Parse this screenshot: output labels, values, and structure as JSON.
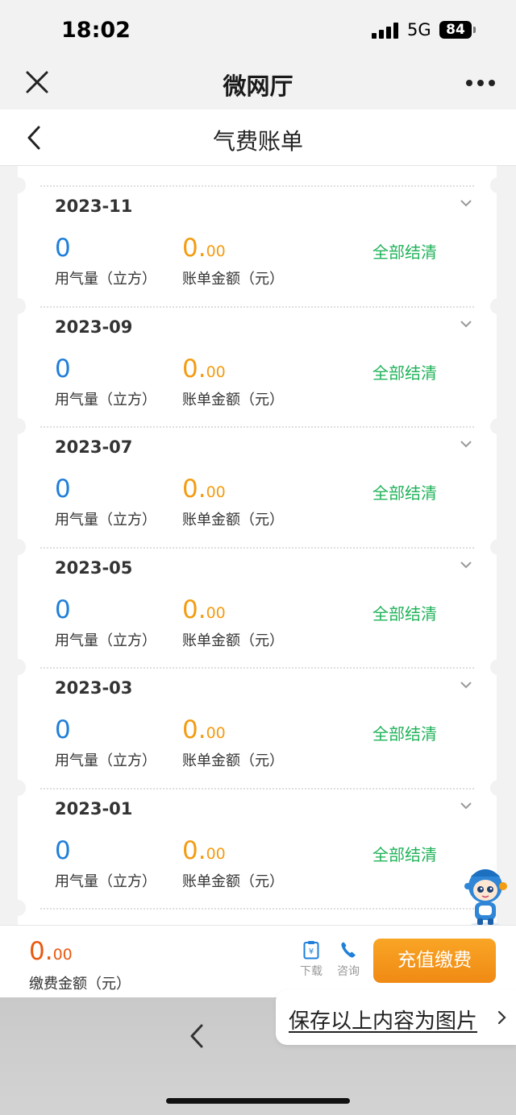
{
  "status_bar": {
    "time": "18:02",
    "network": "5G",
    "battery": "84"
  },
  "app_nav": {
    "title": "微网厅"
  },
  "page": {
    "title": "气费账单"
  },
  "bills": [
    {
      "date": "2023-11",
      "gas_value": "0",
      "gas_label": "用气量（立方）",
      "amount_int": "0.",
      "amount_dec": "00",
      "amount_label": "账单金额（元）",
      "status": "全部结清"
    },
    {
      "date": "2023-09",
      "gas_value": "0",
      "gas_label": "用气量（立方）",
      "amount_int": "0.",
      "amount_dec": "00",
      "amount_label": "账单金额（元）",
      "status": "全部结清"
    },
    {
      "date": "2023-07",
      "gas_value": "0",
      "gas_label": "用气量（立方）",
      "amount_int": "0.",
      "amount_dec": "00",
      "amount_label": "账单金额（元）",
      "status": "全部结清"
    },
    {
      "date": "2023-05",
      "gas_value": "0",
      "gas_label": "用气量（立方）",
      "amount_int": "0.",
      "amount_dec": "00",
      "amount_label": "账单金额（元）",
      "status": "全部结清"
    },
    {
      "date": "2023-03",
      "gas_value": "0",
      "gas_label": "用气量（立方）",
      "amount_int": "0.",
      "amount_dec": "00",
      "amount_label": "账单金额（元）",
      "status": "全部结清"
    },
    {
      "date": "2023-01",
      "gas_value": "0",
      "gas_label": "用气量（立方）",
      "amount_int": "0.",
      "amount_dec": "00",
      "amount_label": "账单金额（元）",
      "status": "全部结清"
    }
  ],
  "bottom_bar": {
    "total_int": "0.",
    "total_dec": "00",
    "total_label": "缴费金额（元）",
    "download_label": "下载",
    "consult_label": "咨询",
    "pay_button": "充值缴费"
  },
  "save_image": {
    "label": "保存以上内容为图片"
  },
  "colors": {
    "gas_value": "#1f7fd9",
    "amount_value": "#f39c12",
    "status_settled": "#21b35a",
    "total_amount": "#e85a10",
    "pay_button": "#f39217"
  },
  "icons": [
    "close-icon",
    "more-icon",
    "back-icon",
    "chevron-down-icon",
    "download-icon",
    "phone-icon",
    "mascot-icon",
    "chevron-right-icon"
  ]
}
